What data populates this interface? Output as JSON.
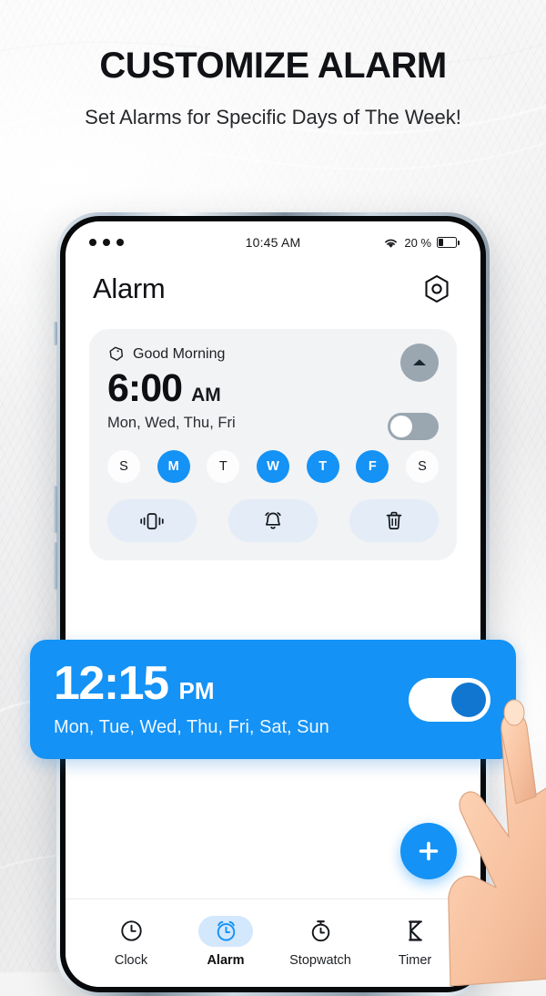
{
  "promo": {
    "title": "CUSTOMIZE ALARM",
    "subtitle": "Set Alarms for Specific Days of The Week!"
  },
  "colors": {
    "accent": "#1492f5",
    "accent_dark": "#1076cf",
    "card_bg": "#f2f3f5",
    "toggle_off": "#9aa6b0",
    "action_btn_bg": "#e3ecf7",
    "nav_active_pill": "#d3e7fd",
    "page_bg": "#f1f1f2"
  },
  "status_bar": {
    "dots_icon": "more-dots-icon",
    "time": "10:45 AM",
    "wifi_icon": "wifi-icon",
    "battery_percent": "20 %",
    "battery_icon": "battery-icon",
    "battery_level": 20
  },
  "app_header": {
    "title": "Alarm",
    "settings_icon": "settings-hexagon-icon"
  },
  "alarm_card": {
    "tag_icon": "tag-icon",
    "label": "Good Morning",
    "time": "6:00",
    "meridiem": "AM",
    "days_text": "Mon, Wed, Thu, Fri",
    "collapse_icon": "chevron-up-icon",
    "enabled": false,
    "day_toggles": [
      {
        "letter": "S",
        "name": "sunday",
        "on": false
      },
      {
        "letter": "M",
        "name": "monday",
        "on": true
      },
      {
        "letter": "T",
        "name": "tuesday",
        "on": false
      },
      {
        "letter": "W",
        "name": "wednesday",
        "on": true
      },
      {
        "letter": "T",
        "name": "thursday",
        "on": true
      },
      {
        "letter": "F",
        "name": "friday",
        "on": true
      },
      {
        "letter": "S",
        "name": "saturday",
        "on": false
      }
    ],
    "actions": [
      {
        "name": "vibrate-button",
        "icon": "vibrate-icon"
      },
      {
        "name": "ringtone-button",
        "icon": "bell-icon"
      },
      {
        "name": "delete-button",
        "icon": "trash-icon"
      }
    ]
  },
  "highlighted_alarm": {
    "time": "12:15",
    "meridiem": "PM",
    "days_text": "Mon, Tue, Wed, Thu, Fri, Sat, Sun",
    "enabled": true,
    "toggle_icon": "toggle-on-icon"
  },
  "fab": {
    "label": "+",
    "icon": "plus-icon"
  },
  "bottom_nav": {
    "items": [
      {
        "label": "Clock",
        "icon": "clock-icon",
        "active": false
      },
      {
        "label": "Alarm",
        "icon": "alarm-clock-icon",
        "active": true
      },
      {
        "label": "Stopwatch",
        "icon": "stopwatch-icon",
        "active": false
      },
      {
        "label": "Timer",
        "icon": "hourglass-icon",
        "active": false
      }
    ]
  },
  "pointer": {
    "icon": "hand-pointer-icon"
  }
}
